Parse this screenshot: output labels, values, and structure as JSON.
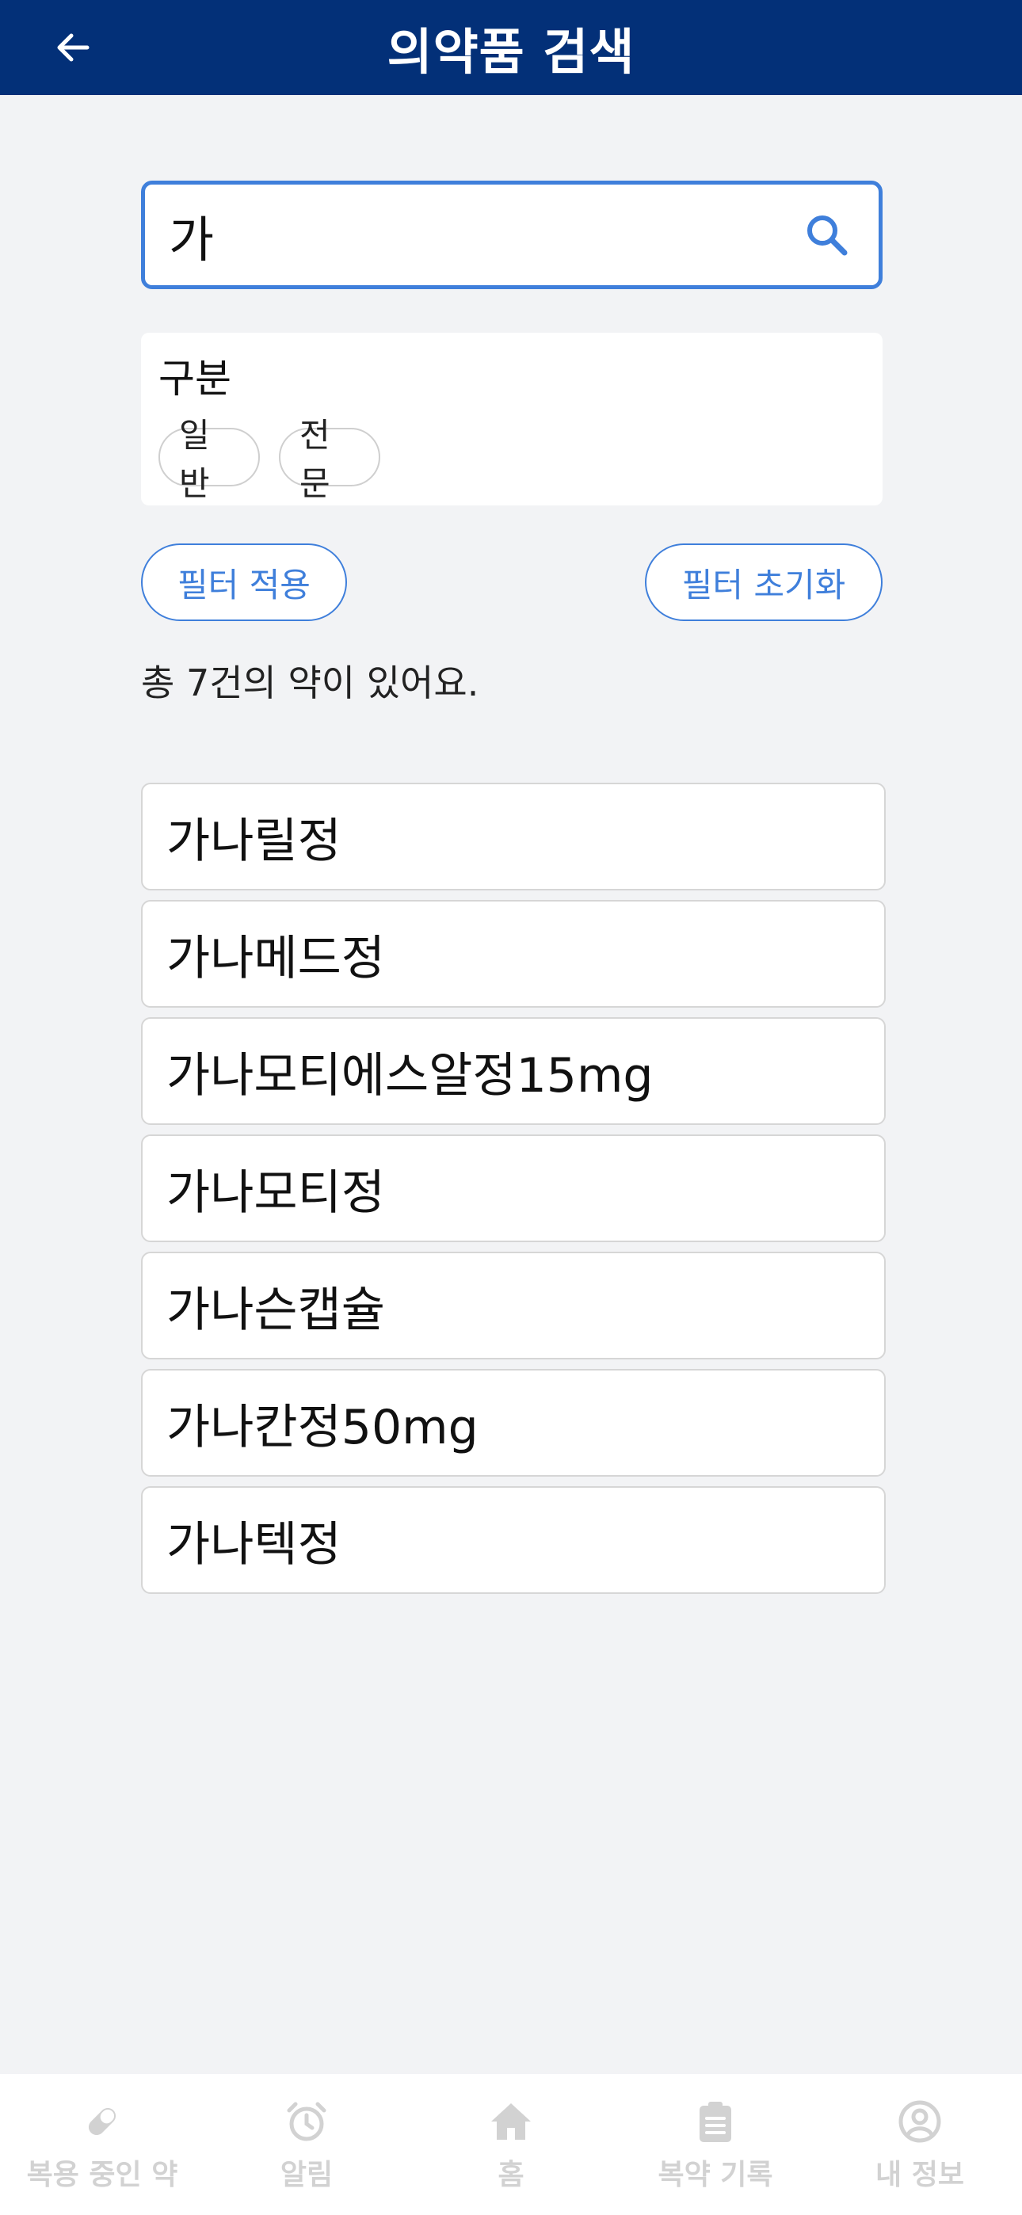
{
  "header": {
    "title": "의약품 검색",
    "back_icon": "arrow-left-icon"
  },
  "search": {
    "value": "가",
    "icon": "search-icon"
  },
  "filter": {
    "label": "구분",
    "chips": [
      "일반",
      "전문"
    ]
  },
  "actions": {
    "apply_label": "필터 적용",
    "reset_label": "필터 초기화"
  },
  "result_count_text": "총 7건의 약이 있어요.",
  "results": [
    "가나릴정",
    "가나메드정",
    "가나모티에스알정15mg",
    "가나모티정",
    "가나슨캡슐",
    "가나칸정50mg",
    "가나텍정"
  ],
  "bottom_nav": [
    {
      "label": "복용 중인 약",
      "icon": "pill-icon"
    },
    {
      "label": "알림",
      "icon": "alarm-clock-icon"
    },
    {
      "label": "홈",
      "icon": "home-icon"
    },
    {
      "label": "복약 기록",
      "icon": "clipboard-icon"
    },
    {
      "label": "내 정보",
      "icon": "user-circle-icon"
    }
  ],
  "colors": {
    "header_bg": "#033078",
    "accent": "#3f7fdb",
    "background": "#f2f3f5",
    "nav_inactive": "#d2d2d2"
  }
}
